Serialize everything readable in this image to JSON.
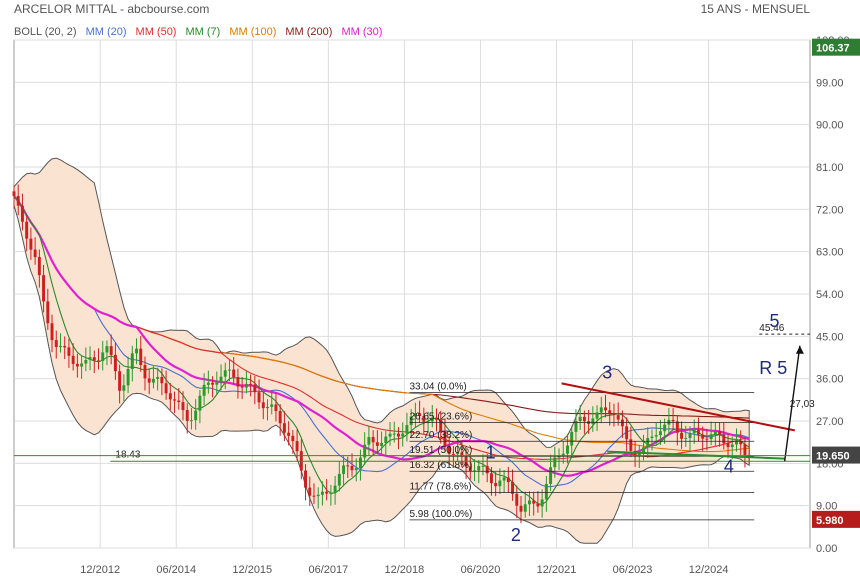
{
  "header": {
    "title": "ARCELOR MITTAL - abcbourse.com",
    "period": "15 ANS - MENSUEL"
  },
  "legend": [
    {
      "label": "BOLL (20, 2)",
      "color": "#555555"
    },
    {
      "label": "MM (20)",
      "color": "#4a6fd0"
    },
    {
      "label": "MM (50)",
      "color": "#e03030"
    },
    {
      "label": "MM (7)",
      "color": "#2a8a2a"
    },
    {
      "label": "MM (100)",
      "color": "#e07b00"
    },
    {
      "label": "MM (200)",
      "color": "#8b1a1a"
    },
    {
      "label": "MM (30)",
      "color": "#e020d0"
    }
  ],
  "colors": {
    "up": "#2a9a2a",
    "down": "#cc2020",
    "band_fill": "#fbe3d2",
    "grid": "#dddddd",
    "current_badge": "#2e7d32",
    "min_badge": "#b71c1c",
    "wave": "#1f2a80"
  },
  "chart_data": {
    "type": "candlestick",
    "x_ticks": [
      "12/2012",
      "06/2014",
      "12/2015",
      "06/2017",
      "12/2018",
      "06/2020",
      "12/2021",
      "06/2023",
      "12/2024"
    ],
    "y_ticks": [
      0,
      9,
      18,
      27,
      36,
      45,
      54,
      63,
      72,
      81,
      90,
      99,
      108
    ],
    "ylim": [
      0,
      108
    ],
    "start_year": 2010.2,
    "end_year": 2025.9,
    "price_path": [
      [
        2010.2,
        75
      ],
      [
        2010.4,
        68
      ],
      [
        2010.6,
        62
      ],
      [
        2010.8,
        50
      ],
      [
        2011.0,
        45
      ],
      [
        2011.3,
        40
      ],
      [
        2011.6,
        38
      ],
      [
        2012.0,
        44
      ],
      [
        2012.3,
        33
      ],
      [
        2012.6,
        42
      ],
      [
        2012.9,
        36
      ],
      [
        2013.3,
        32
      ],
      [
        2013.6,
        28
      ],
      [
        2013.9,
        32
      ],
      [
        2014.2,
        36
      ],
      [
        2014.5,
        38
      ],
      [
        2014.9,
        32
      ],
      [
        2015.3,
        30
      ],
      [
        2015.6,
        25
      ],
      [
        2015.9,
        14
      ],
      [
        2016.2,
        11
      ],
      [
        2016.6,
        14
      ],
      [
        2016.9,
        18
      ],
      [
        2017.2,
        23
      ],
      [
        2017.6,
        22
      ],
      [
        2017.9,
        27
      ],
      [
        2018.2,
        28
      ],
      [
        2018.5,
        26
      ],
      [
        2018.8,
        22
      ],
      [
        2019.1,
        17
      ],
      [
        2019.5,
        16
      ],
      [
        2019.8,
        15
      ],
      [
        2020.2,
        8
      ],
      [
        2020.5,
        10
      ],
      [
        2020.8,
        16
      ],
      [
        2021.1,
        22
      ],
      [
        2021.4,
        29
      ],
      [
        2021.7,
        27
      ],
      [
        2022.0,
        30
      ],
      [
        2022.3,
        23
      ],
      [
        2022.6,
        19
      ],
      [
        2022.9,
        26
      ],
      [
        2023.2,
        27
      ],
      [
        2023.5,
        22
      ],
      [
        2023.8,
        25
      ],
      [
        2024.1,
        24
      ],
      [
        2024.4,
        21
      ],
      [
        2024.7,
        19.65
      ]
    ],
    "fibonacci": [
      {
        "label": "33.04  (0.0%)",
        "value": 33.04
      },
      {
        "label": "26.65  (23.6%)",
        "value": 26.65
      },
      {
        "label": "22.70  (38.2%)",
        "value": 22.7
      },
      {
        "label": "19.51  (50.0%)",
        "value": 19.51
      },
      {
        "label": "16.32  (61.8%)",
        "value": 16.32
      },
      {
        "label": "11.77  (78.6%)",
        "value": 11.77
      },
      {
        "label": "5.98  (100.0%)",
        "value": 5.98
      }
    ],
    "support_label": "18.43",
    "support_value": 18.43,
    "target_label": "45.46",
    "target_value": 45.46,
    "resistance_label": "R 5",
    "measure_label": "27,03",
    "waves": [
      {
        "label": "1",
        "year": 2019.6,
        "value": 19
      },
      {
        "label": "2",
        "year": 2020.1,
        "value": 1.5
      },
      {
        "label": "3",
        "year": 2021.9,
        "value": 36
      },
      {
        "label": "4",
        "year": 2024.3,
        "value": 16
      },
      {
        "label": "5",
        "year": 2025.2,
        "value": 47
      }
    ],
    "current_price": "19.650",
    "current_value": 19.65,
    "top_price": "106.37",
    "top_value": 106.37,
    "min_price": "5.980",
    "min_value": 5.98
  }
}
